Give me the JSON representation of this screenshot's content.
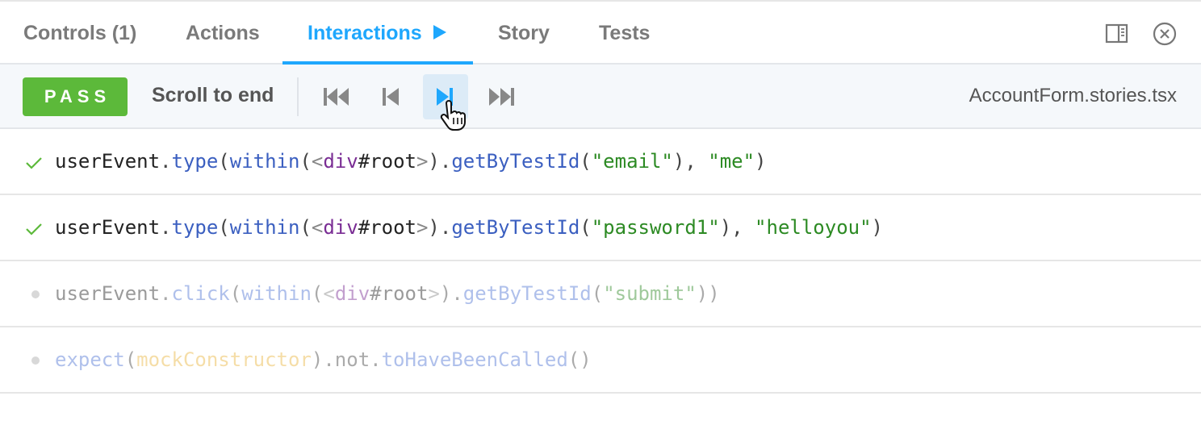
{
  "tabs": {
    "controls": "Controls (1)",
    "actions": "Actions",
    "interactions": "Interactions",
    "story": "Story",
    "tests": "Tests"
  },
  "toolbar": {
    "status": "PASS",
    "scroll_label": "Scroll to end",
    "filename": "AccountForm.stories.tsx"
  },
  "rows": [
    {
      "state": "pass",
      "obj": "userEvent",
      "dot1": ".",
      "method": "type",
      "p1": "(",
      "within": "within",
      "p2": "(",
      "lt": "<",
      "tag": "div",
      "sel": "#root",
      "gt": ">",
      "p3": ").",
      "getter": "getByTestId",
      "p4": "(",
      "arg1": "\"email\"",
      "p5": "), ",
      "arg2": "\"me\"",
      "p6": ")"
    },
    {
      "state": "pass",
      "obj": "userEvent",
      "dot1": ".",
      "method": "type",
      "p1": "(",
      "within": "within",
      "p2": "(",
      "lt": "<",
      "tag": "div",
      "sel": "#root",
      "gt": ">",
      "p3": ").",
      "getter": "getByTestId",
      "p4": "(",
      "arg1": "\"password1\"",
      "p5": "), ",
      "arg2": "\"helloyou\"",
      "p6": ")"
    },
    {
      "state": "pending",
      "obj": "userEvent",
      "dot1": ".",
      "method": "click",
      "p1": "(",
      "within": "within",
      "p2": "(",
      "lt": "<",
      "tag": "div",
      "sel": "#root",
      "gt": ">",
      "p3": ").",
      "getter": "getByTestId",
      "p4": "(",
      "arg1": "\"submit\"",
      "p5": "))"
    },
    {
      "state": "pending",
      "fn": "expect",
      "p1": "(",
      "arg": "mockConstructor",
      "p2": ").not.",
      "method": "toHaveBeenCalled",
      "p3": "()"
    }
  ],
  "colors": {
    "accent": "#1ea7fd",
    "pass": "#5cb93a"
  },
  "icons": [
    "sidebar-toggle-icon",
    "close-icon",
    "check-icon",
    "pending-dot-icon",
    "rewind-icon",
    "step-back-icon",
    "step-forward-icon",
    "fast-forward-icon",
    "hand-cursor-icon",
    "play-icon"
  ]
}
